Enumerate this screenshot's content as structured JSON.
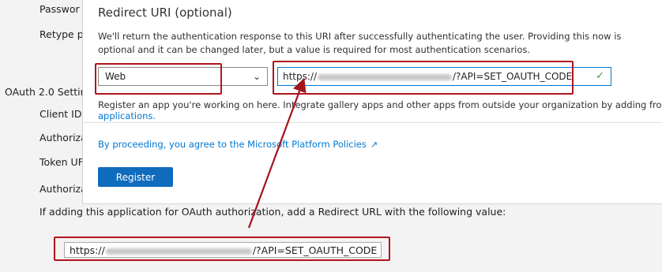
{
  "background": {
    "labels": [
      {
        "key": "password",
        "text": "Passwor"
      },
      {
        "key": "retype",
        "text": "Retype p"
      },
      {
        "key": "oauth",
        "text": "OAuth 2.0 Settir"
      },
      {
        "key": "client_id",
        "text": "Client ID"
      },
      {
        "key": "authorize",
        "text": "Authoriza"
      },
      {
        "key": "token",
        "text": "Token UF"
      },
      {
        "key": "authorize2",
        "text": "Authoriza"
      }
    ],
    "hint": "If adding this application for OAuth authorization, add a Redirect URL with the following value:",
    "url_prefix": "https://",
    "url_suffix": "/?API=SET_OAUTH_CODE"
  },
  "panel": {
    "title": "Redirect URI (optional)",
    "description": "We'll return the authentication response to this URI after successfully authenticating the user. Providing this now is optional and it can be changed later, but a value is required for most authentication scenarios.",
    "platform_select": {
      "value": "Web",
      "icon": "chevron-down-icon"
    },
    "uri_input": {
      "prefix": "https://",
      "suffix": "/?API=SET_OAUTH_CODE",
      "icon": "checkmark-icon"
    },
    "register_text": "Register an app you're working on here. Integrate gallery apps and other apps from outside your organization by adding from",
    "register_link": "applications.",
    "policy_link": "By proceeding, you agree to the Microsoft Platform Policies",
    "policy_icon": "external-link-icon",
    "register_button": "Register"
  },
  "colors": {
    "highlight": "#b0151d",
    "accent": "#0078d4",
    "button": "#0f6cbd",
    "valid": "#3a9a3a"
  }
}
